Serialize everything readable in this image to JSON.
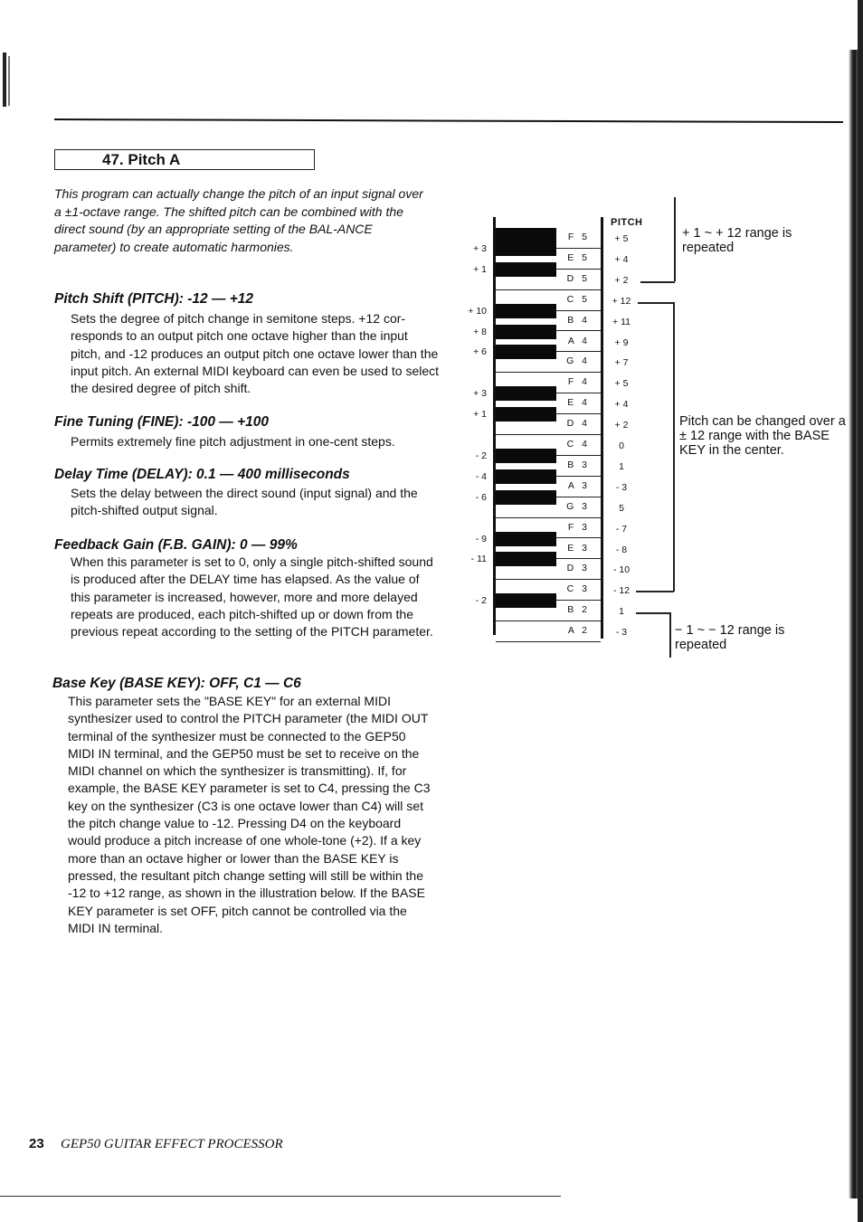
{
  "header": {
    "section_title": "47. Pitch A"
  },
  "intro": "This program can actually change the pitch of an input signal over a ±1-octave range. The shifted pitch can be combined with the direct sound (by an appropriate setting of the BAL-ANCE  parameter) to create automatic harmonies.",
  "parameters": [
    {
      "heading": "Pitch Shift (PITCH): -12 — +12",
      "body": "Sets the degree of pitch change in semitone steps. +12 cor-responds to an output pitch one octave higher than the input pitch, and -12 produces an output pitch one octave lower than the  input pitch. An external MIDI keyboard can even be used to select  the desired degree of pitch shift."
    },
    {
      "heading": "Fine Tuning (FINE): -100 — +100",
      "body": "Permits extremely fine pitch adjustment in one-cent steps."
    },
    {
      "heading": "Delay Time (DELAY): 0.1 — 400 milliseconds",
      "body": "Sets the delay between the direct sound (input signal) and the pitch-shifted output signal."
    },
    {
      "heading": "Feedback Gain (F.B. GAIN): 0 — 99%",
      "body": "When this parameter is set to 0, only a single pitch-shifted sound is produced after the DELAY time has elapsed. As the value  of this parameter is increased, however, more and more delayed  repeats are produced, each pitch-shifted up or down from the previous repeat according to the setting of the PITCH parameter."
    },
    {
      "heading": "Base Key (BASE KEY): OFF, C1 — C6",
      "body": "This parameter sets the \"BASE KEY\" for an external MIDI synthesizer used to control the PITCH parameter (the MIDI OUT terminal of the synthesizer must be connected to the GEP50 MIDI IN  terminal, and the GEP50 must be set to receive on the MIDI channel on which the synthesizer is transmitting). If, for example,  the BASE KEY parameter is set to C4, pressing the C3 key on the  synthesizer (C3 is one octave lower than C4) will set the pitch  change value to -12. Pressing  D4 on the keyboard would produce a  pitch increase of one whole-tone (+2). If a key more than an octave higher or lower than the BASE KEY is pressed, the resultant  pitch change setting will still be within the -12 to +12 range,  as shown in the illustration below. If the BASE KEY parameter is  set OFF, pitch cannot be controlled via the MIDI IN terminal."
    }
  ],
  "diagram": {
    "pitch_header": "PITCH",
    "white_keys": [
      {
        "note": "F 5",
        "pitch": "+ 5"
      },
      {
        "note": "E 5",
        "pitch": "+ 4"
      },
      {
        "note": "D 5",
        "pitch": "+ 2"
      },
      {
        "note": "C 5",
        "pitch": "+ 12"
      },
      {
        "note": "B 4",
        "pitch": "+ 11"
      },
      {
        "note": "A 4",
        "pitch": "+ 9"
      },
      {
        "note": "G 4",
        "pitch": "+ 7"
      },
      {
        "note": "F 4",
        "pitch": "+ 5"
      },
      {
        "note": "E 4",
        "pitch": "+ 4"
      },
      {
        "note": "D 4",
        "pitch": "+ 2"
      },
      {
        "note": "C 4",
        "pitch": "0"
      },
      {
        "note": "B 3",
        "pitch": "1"
      },
      {
        "note": "A 3",
        "pitch": "- 3"
      },
      {
        "note": "G 3",
        "pitch": "5"
      },
      {
        "note": "F 3",
        "pitch": "- 7"
      },
      {
        "note": "E 3",
        "pitch": "- 8"
      },
      {
        "note": "D 3",
        "pitch": "- 10"
      },
      {
        "note": "C 3",
        "pitch": "- 12"
      },
      {
        "note": "B 2",
        "pitch": "1"
      },
      {
        "note": "A 2",
        "pitch": "- 3"
      }
    ],
    "black_key_labels": [
      "+ 3",
      "+ 1",
      "+ 10",
      "+ 8",
      "+ 6",
      "+ 3",
      "+ 1",
      "- 2",
      "- 4",
      "- 6",
      "- 9",
      "- 11",
      "- 2"
    ],
    "notes": {
      "upper": "+ 1 ~ + 12 range is repeated",
      "middle": "Pitch can be changed over a ± 12 range with the BASE KEY in the center.",
      "lower": "− 1 ~ − 12 range is repeated"
    }
  },
  "footer": {
    "page_number": "23",
    "title": "GEP50 GUITAR EFFECT PROCESSOR"
  }
}
